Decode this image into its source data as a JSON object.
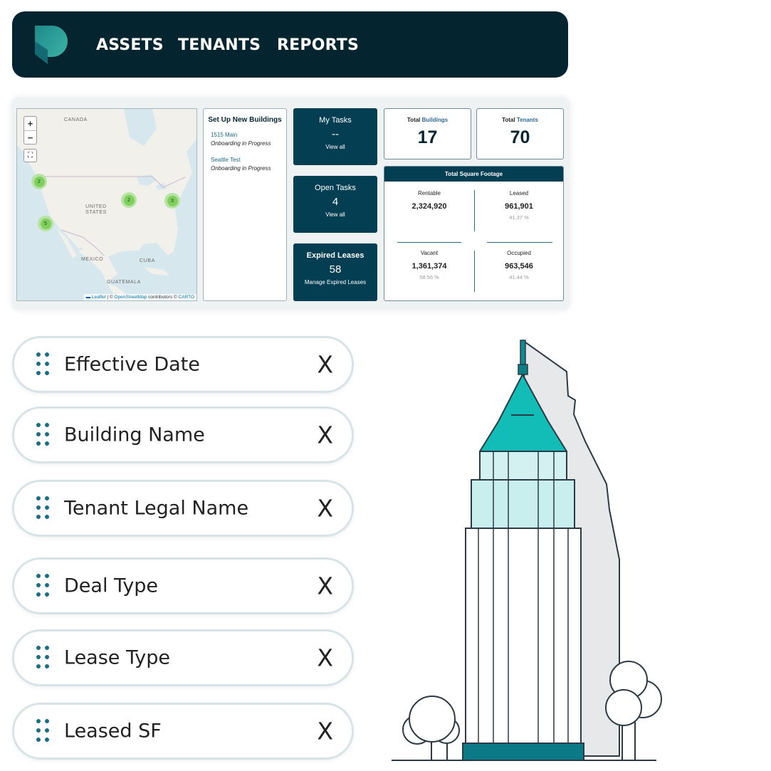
{
  "nav": {
    "items": [
      "ASSETS",
      "TENANTS",
      "REPORTS"
    ]
  },
  "map": {
    "zoom_in": "+",
    "zoom_out": "−",
    "labels": {
      "canada": "CANADA",
      "us": "UNITED STATES",
      "mexico": "MEXICO",
      "cuba": "CUBA",
      "guatemala": "GUATEMALA"
    },
    "clusters": [
      "2",
      "2",
      "3",
      "5"
    ],
    "attribution": {
      "leaflet": "Leaflet",
      "sep": " | © ",
      "osm": "OpenStreetMap",
      "contrib": " contributors © ",
      "carto": "CARTO"
    }
  },
  "setup": {
    "title": "Set Up New Buildings",
    "items": [
      {
        "name": "1515 Main",
        "status": "Onboarding in Progress"
      },
      {
        "name": "Seattle Test",
        "status": "Onboarding in Progress"
      }
    ]
  },
  "tasks": [
    {
      "title": "My Tasks",
      "value": "--",
      "link": "View all"
    },
    {
      "title": "Open Tasks",
      "value": "4",
      "link": "View all"
    },
    {
      "title": "Expired Leases",
      "value": "58",
      "link": "Manage Expired Leases"
    }
  ],
  "stats": {
    "buildings": {
      "prefix": "Total ",
      "accent": "Buildings",
      "value": "17"
    },
    "tenants": {
      "prefix": "Total ",
      "accent": "Tenants",
      "value": "70"
    }
  },
  "sqft": {
    "title": "Total Square Footage",
    "rentable": {
      "label": "Rentable",
      "value": "2,324,920"
    },
    "leased": {
      "label": "Leased",
      "value": "961,901",
      "pct": "41.37 %"
    },
    "vacant": {
      "label": "Vacant",
      "value": "1,361,374",
      "pct": "58.56 %"
    },
    "occupied": {
      "label": "Occupied",
      "value": "963,546",
      "pct": "41.44 %"
    }
  },
  "fields": [
    {
      "label": "Effective Date",
      "remove": "X"
    },
    {
      "label": "Building Name",
      "remove": "X"
    },
    {
      "label": "Tenant Legal Name",
      "remove": "X"
    },
    {
      "label": "Deal Type",
      "remove": "X"
    },
    {
      "label": "Lease Type",
      "remove": "X"
    },
    {
      "label": "Leased SF",
      "remove": "X"
    }
  ],
  "colors": {
    "nav_bg": "#04252f",
    "tile_bg": "#043e52",
    "accent_teal": "#1b6f83",
    "building_teal": "#0fbab3"
  }
}
